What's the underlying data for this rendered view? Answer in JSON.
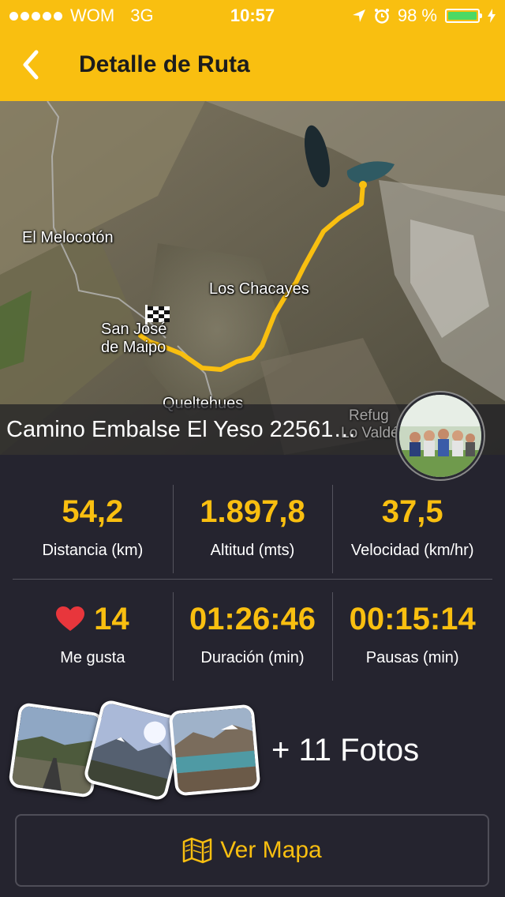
{
  "status_bar": {
    "carrier": "WOM",
    "network": "3G",
    "time": "10:57",
    "battery": "98 %",
    "battery_level": 0.98
  },
  "navbar": {
    "title": "Detalle de Ruta"
  },
  "map": {
    "labels": {
      "el_melocoton": "El Melocotón",
      "los_chacayes": "Los Chacayes",
      "san_jose_1": "San José",
      "san_jose_2": "de Maipo",
      "queltehues": "Queltehues",
      "refugio_1": "Refug",
      "refugio_2": "Lo Valdé"
    },
    "route_color": "#f9bf10",
    "caption": "Camino Embalse El Yeso 22561…"
  },
  "stats": {
    "distance": {
      "value": "54,2",
      "label": "Distancia (km)"
    },
    "altitude": {
      "value": "1.897,8",
      "label": "Altitud (mts)"
    },
    "speed": {
      "value": "37,5",
      "label": "Velocidad (km/hr)"
    },
    "likes": {
      "value": "14",
      "label": "Me gusta",
      "icon": "heart-icon"
    },
    "duration": {
      "value": "01:26:46",
      "label": "Duración (min)"
    },
    "pauses": {
      "value": "00:15:14",
      "label": "Pausas (min)"
    }
  },
  "photos": {
    "more_label": "+ 11 Fotos"
  },
  "map_button": {
    "label": "Ver Mapa",
    "icon": "map-icon"
  },
  "colors": {
    "accent": "#f9bf10",
    "background": "#25242f",
    "heart": "#e8363c"
  }
}
